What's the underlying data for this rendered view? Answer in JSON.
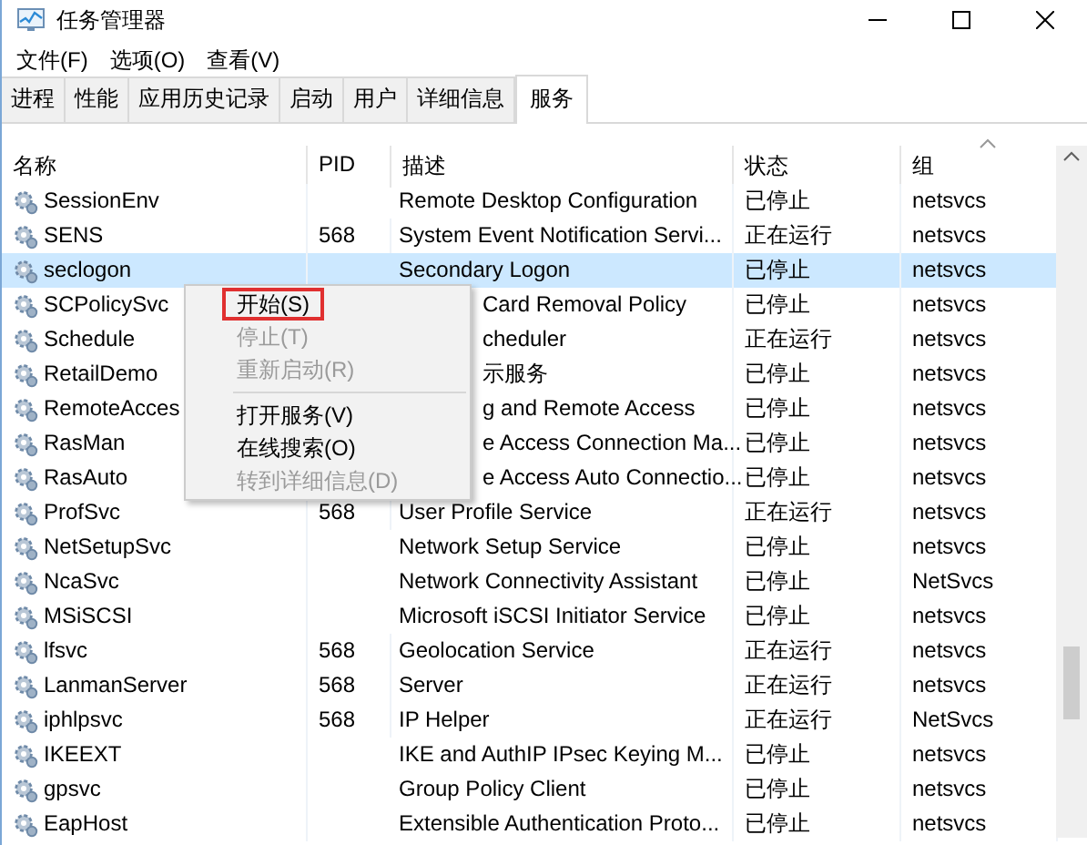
{
  "window": {
    "title": "任务管理器"
  },
  "menu_bar": [
    "文件(F)",
    "选项(O)",
    "查看(V)"
  ],
  "tabs": [
    {
      "label": "进程",
      "selected": false
    },
    {
      "label": "性能",
      "selected": false
    },
    {
      "label": "应用历史记录",
      "selected": false
    },
    {
      "label": "启动",
      "selected": false
    },
    {
      "label": "用户",
      "selected": false
    },
    {
      "label": "详细信息",
      "selected": false
    },
    {
      "label": "服务",
      "selected": true
    }
  ],
  "table": {
    "columns": [
      "名称",
      "PID",
      "描述",
      "状态",
      "组"
    ],
    "rows": [
      {
        "name": "SessionEnv",
        "pid": "",
        "description": "Remote Desktop Configuration",
        "status": "已停止",
        "group": "netsvcs",
        "selected": false,
        "partly_hidden": false
      },
      {
        "name": "SENS",
        "pid": "568",
        "description": "System Event Notification Servi...",
        "status": "正在运行",
        "group": "netsvcs",
        "selected": false,
        "partly_hidden": false
      },
      {
        "name": "seclogon",
        "pid": "",
        "description": "Secondary Logon",
        "status": "已停止",
        "group": "netsvcs",
        "selected": true,
        "partly_hidden": false
      },
      {
        "name": "SCPolicySvc",
        "description": "Card Removal Policy",
        "status": "已停止",
        "group": "netsvcs",
        "selected": false,
        "partly_hidden": true
      },
      {
        "name": "Schedule",
        "description": "cheduler",
        "status": "正在运行",
        "group": "netsvcs",
        "selected": false,
        "partly_hidden": true
      },
      {
        "name": "RetailDemo",
        "description": "示服务",
        "status": "已停止",
        "group": "netsvcs",
        "selected": false,
        "partly_hidden": true
      },
      {
        "name": "RemoteAcces",
        "description": "g and Remote Access",
        "status": "已停止",
        "group": "netsvcs",
        "selected": false,
        "partly_hidden": true
      },
      {
        "name": "RasMan",
        "description": "e Access Connection Ma...",
        "status": "已停止",
        "group": "netsvcs",
        "selected": false,
        "partly_hidden": true
      },
      {
        "name": "RasAuto",
        "description": "e Access Auto Connectio...",
        "status": "已停止",
        "group": "netsvcs",
        "selected": false,
        "partly_hidden": true
      },
      {
        "name": "ProfSvc",
        "pid": "568",
        "description": "User Profile Service",
        "status": "正在运行",
        "group": "netsvcs",
        "selected": false,
        "partly_hidden": false
      },
      {
        "name": "NetSetupSvc",
        "pid": "",
        "description": "Network Setup Service",
        "status": "已停止",
        "group": "netsvcs",
        "selected": false,
        "partly_hidden": false
      },
      {
        "name": "NcaSvc",
        "pid": "",
        "description": "Network Connectivity Assistant",
        "status": "已停止",
        "group": "NetSvcs",
        "selected": false,
        "partly_hidden": false
      },
      {
        "name": "MSiSCSI",
        "pid": "",
        "description": "Microsoft iSCSI Initiator Service",
        "status": "已停止",
        "group": "netsvcs",
        "selected": false,
        "partly_hidden": false
      },
      {
        "name": "lfsvc",
        "pid": "568",
        "description": "Geolocation Service",
        "status": "正在运行",
        "group": "netsvcs",
        "selected": false,
        "partly_hidden": false
      },
      {
        "name": "LanmanServer",
        "pid": "568",
        "description": "Server",
        "status": "正在运行",
        "group": "netsvcs",
        "selected": false,
        "partly_hidden": false
      },
      {
        "name": "iphlpsvc",
        "pid": "568",
        "description": "IP Helper",
        "status": "正在运行",
        "group": "NetSvcs",
        "selected": false,
        "partly_hidden": false
      },
      {
        "name": "IKEEXT",
        "pid": "",
        "description": "IKE and AuthIP IPsec Keying M...",
        "status": "已停止",
        "group": "netsvcs",
        "selected": false,
        "partly_hidden": false
      },
      {
        "name": "gpsvc",
        "pid": "",
        "description": "Group Policy Client",
        "status": "已停止",
        "group": "netsvcs",
        "selected": false,
        "partly_hidden": false
      },
      {
        "name": "EapHost",
        "pid": "",
        "description": "Extensible Authentication Proto...",
        "status": "已停止",
        "group": "netsvcs",
        "selected": false,
        "partly_hidden": false
      }
    ]
  },
  "context_menu": [
    {
      "kind": "item",
      "label": "开始(S)",
      "disabled": false,
      "highlighted": true
    },
    {
      "kind": "item",
      "label": "停止(T)",
      "disabled": true,
      "highlighted": false
    },
    {
      "kind": "item",
      "label": "重新启动(R)",
      "disabled": true,
      "highlighted": false
    },
    {
      "kind": "separator"
    },
    {
      "kind": "item",
      "label": "打开服务(V)",
      "disabled": false,
      "highlighted": false
    },
    {
      "kind": "item",
      "label": "在线搜索(O)",
      "disabled": false,
      "highlighted": false
    },
    {
      "kind": "item",
      "label": "转到详细信息(D)",
      "disabled": true,
      "highlighted": false
    }
  ]
}
